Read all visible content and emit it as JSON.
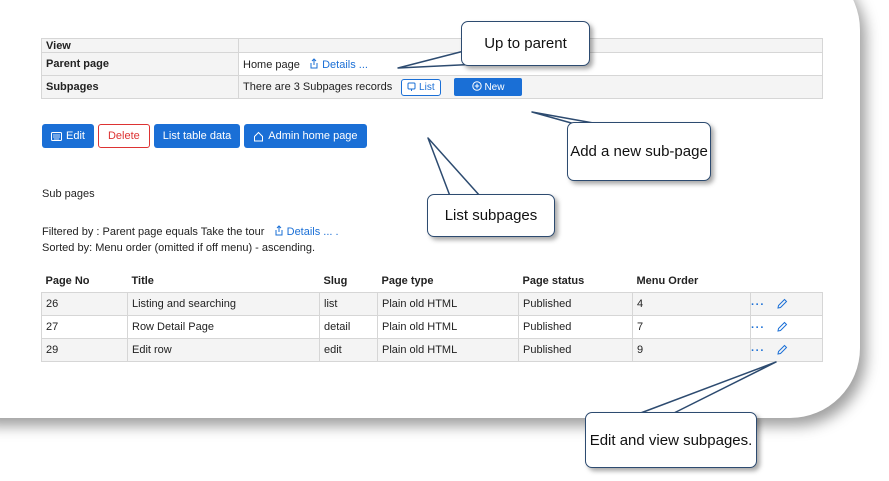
{
  "detail": {
    "top_label": "View",
    "parent_label": "Parent page",
    "parent_value": "Home page",
    "parent_link": "Details ...",
    "subpages_label": "Subpages",
    "subpages_value": "There are 3 Subpages records",
    "list_button": "List",
    "new_button": "New"
  },
  "actions": {
    "edit": "Edit",
    "delete": "Delete",
    "list_table": "List table data",
    "admin_home": "Admin home page"
  },
  "section_title": "Sub pages",
  "filter": {
    "filtered_by": "Filtered by : Parent page equals Take the tour",
    "details_link": "Details ... .",
    "sorted_by": "Sorted by: Menu order (omitted if off menu) - ascending."
  },
  "subtable": {
    "headers": [
      "Page No",
      "Title",
      "Slug",
      "Page type",
      "Page status",
      "Menu Order"
    ],
    "rows": [
      [
        "26",
        "Listing and searching",
        "list",
        "Plain old HTML",
        "Published",
        "4"
      ],
      [
        "27",
        "Row Detail Page",
        "detail",
        "Plain old HTML",
        "Published",
        "7"
      ],
      [
        "29",
        "Edit row",
        "edit",
        "Plain old HTML",
        "Published",
        "9"
      ]
    ],
    "more_glyph": "···"
  },
  "callouts": {
    "up_to_parent": "Up to parent",
    "add_new": "Add a new sub-page",
    "list_subpages": "List subpages",
    "edit_view": "Edit and view subpages."
  },
  "colors": {
    "accent": "#1a6fd6",
    "danger": "#d33333",
    "callout_border": "#2d4b70"
  }
}
